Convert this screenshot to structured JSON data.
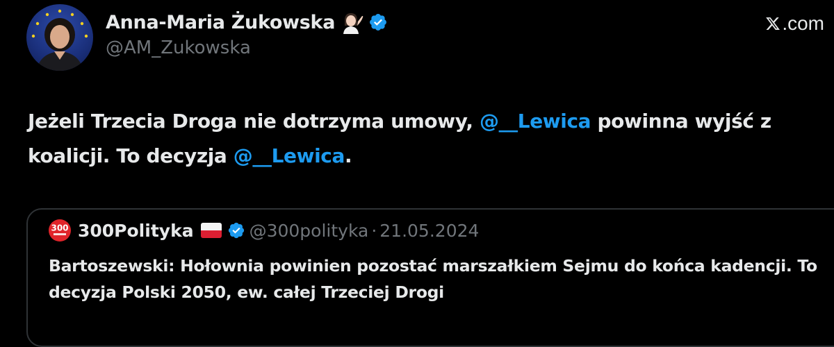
{
  "author": {
    "display_name": "Anna-Maria Żukowska",
    "emoji": "woman-tipping-hand-emoji",
    "verified": true,
    "handle": "@AM_Zukowska"
  },
  "site_label": ".com",
  "tweet": {
    "segments": [
      {
        "text": "Jeżeli Trzecia Droga nie dotrzyma umowy, ",
        "type": "text"
      },
      {
        "text": "@__Lewica",
        "type": "mention"
      },
      {
        "text": " powinna wyjść z koalicji. To decyzja ",
        "type": "text"
      },
      {
        "text": "@__Lewica",
        "type": "mention"
      },
      {
        "text": ".",
        "type": "text"
      }
    ]
  },
  "quoted": {
    "logo_text": "300",
    "name": "300Polityka",
    "flag": "poland-flag-icon",
    "verified": true,
    "handle": "@300polityka",
    "separator": "·",
    "date": "21.05.2024",
    "text": "Bartoszewski: Hołownia powinien pozostać marszałkiem Sejmu do końca kadencji. To decyzja Polski 2050, ew. całej Trzeciej Drogi"
  },
  "colors": {
    "background": "#000000",
    "text": "#e7e9ea",
    "muted": "#71767b",
    "accent": "#1d9bf0",
    "border": "#2f3336"
  }
}
